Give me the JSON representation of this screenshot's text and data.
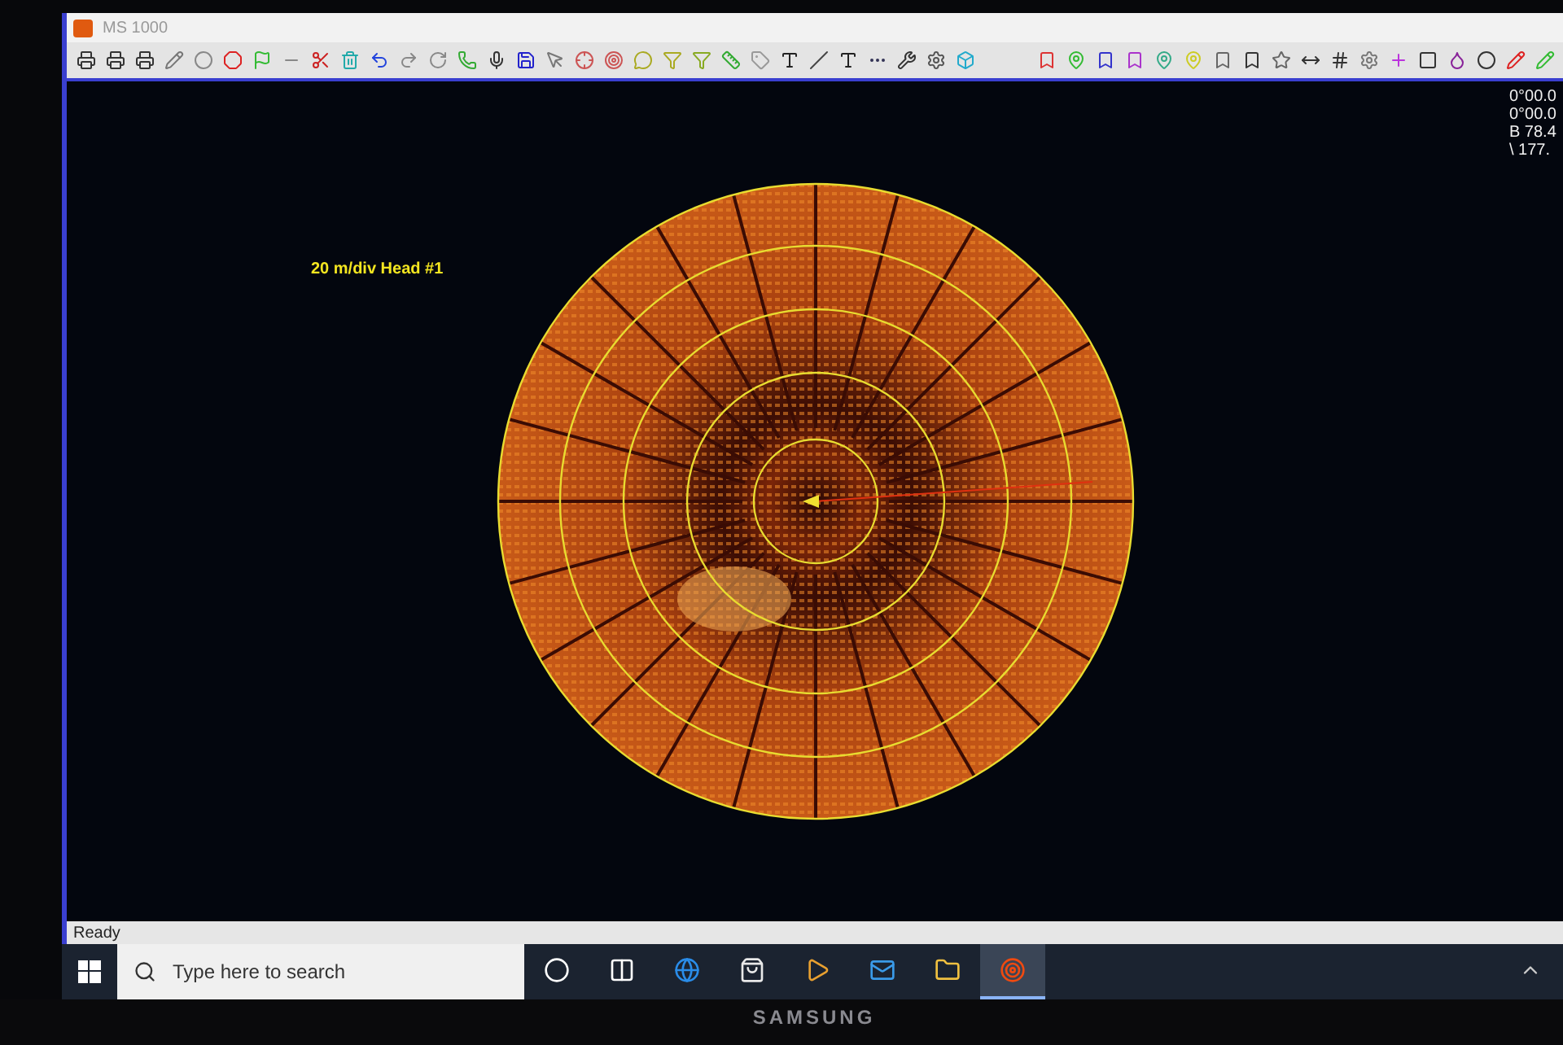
{
  "window": {
    "title": "MS 1000"
  },
  "readouts": [
    "0°00.0",
    "0°00.0",
    "B 78.4",
    "\\ 177."
  ],
  "sonar": {
    "scale_label": "20 m/div Head #1"
  },
  "status_bar": {
    "text": "Ready"
  },
  "taskbar": {
    "search": {
      "placeholder": "Type here to search"
    },
    "apps": [
      {
        "kind": "cortana",
        "selected": false
      },
      {
        "kind": "taskview",
        "selected": false
      },
      {
        "kind": "browser",
        "selected": false
      },
      {
        "kind": "store",
        "selected": false
      },
      {
        "kind": "media",
        "selected": false
      },
      {
        "kind": "mail",
        "selected": false
      },
      {
        "kind": "folder",
        "selected": false
      },
      {
        "kind": "sonar",
        "selected": true
      }
    ]
  },
  "bezel": {
    "brand": "SAMSUNG"
  }
}
